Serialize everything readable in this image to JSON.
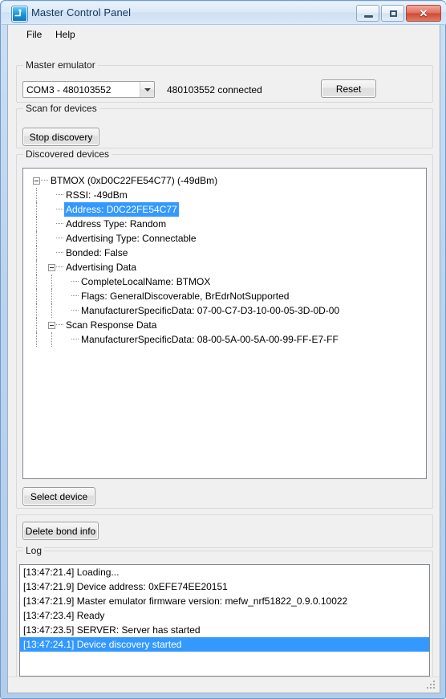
{
  "window": {
    "title": "Master Control Panel",
    "icon": "app-icon",
    "buttons": {
      "minimize": "–",
      "maximize": "□",
      "close": "✕"
    }
  },
  "menubar": {
    "items": [
      {
        "label": "File"
      },
      {
        "label": "Help"
      }
    ]
  },
  "emulator": {
    "group_title": "Master emulator",
    "combo_value": "COM3 - 480103552",
    "combo_options": [
      "COM3 - 480103552"
    ],
    "status_text": "480103552 connected",
    "reset_label": "Reset"
  },
  "scan": {
    "group_title": "Scan for devices",
    "discovery_button": "Stop discovery"
  },
  "devices": {
    "group_title": "Discovered devices",
    "select_button": "Select device",
    "tree": [
      {
        "level": 0,
        "expander": "minus",
        "label": "BTMOX (0xD0C22FE54C77) (-49dBm)",
        "selected": false
      },
      {
        "level": 1,
        "expander": "none",
        "label": "RSSI: -49dBm",
        "selected": false
      },
      {
        "level": 1,
        "expander": "none",
        "label": "Address: D0C22FE54C77",
        "selected": true
      },
      {
        "level": 1,
        "expander": "none",
        "label": "Address Type: Random",
        "selected": false
      },
      {
        "level": 1,
        "expander": "none",
        "label": "Advertising Type: Connectable",
        "selected": false
      },
      {
        "level": 1,
        "expander": "none",
        "label": "Bonded: False",
        "selected": false
      },
      {
        "level": 1,
        "expander": "minus",
        "label": "Advertising Data",
        "selected": false
      },
      {
        "level": 2,
        "expander": "none",
        "label": "CompleteLocalName: BTMOX",
        "selected": false
      },
      {
        "level": 2,
        "expander": "none",
        "label": "Flags: GeneralDiscoverable, BrEdrNotSupported",
        "selected": false
      },
      {
        "level": 2,
        "expander": "none",
        "label": "ManufacturerSpecificData: 07-00-C7-D3-10-00-05-3D-0D-00",
        "selected": false
      },
      {
        "level": 1,
        "expander": "minus",
        "label": "Scan Response Data",
        "selected": false
      },
      {
        "level": 2,
        "expander": "none",
        "label": "ManufacturerSpecificData: 08-00-5A-00-5A-00-99-FF-E7-FF",
        "selected": false
      }
    ]
  },
  "bond": {
    "delete_button": "Delete bond info"
  },
  "log": {
    "group_title": "Log",
    "entries": [
      {
        "text": "[13:47:21.4] Loading...",
        "selected": false
      },
      {
        "text": "[13:47:21.9] Device address: 0xEFE74EE20151",
        "selected": false
      },
      {
        "text": "[13:47:21.9] Master emulator firmware version: mefw_nrf51822_0.9.0.10022",
        "selected": false
      },
      {
        "text": "[13:47:23.4] Ready",
        "selected": false
      },
      {
        "text": "[13:47:23.5] SERVER: Server has started",
        "selected": false
      },
      {
        "text": "[13:47:24.1] Device discovery started",
        "selected": true
      }
    ]
  },
  "colors": {
    "selection_blue": "#3399ff",
    "titlebar_text": "#14365c",
    "close_button_red": "#cf4a34",
    "window_frame": "#b3cde9",
    "client_background": "#f0f0f0"
  }
}
